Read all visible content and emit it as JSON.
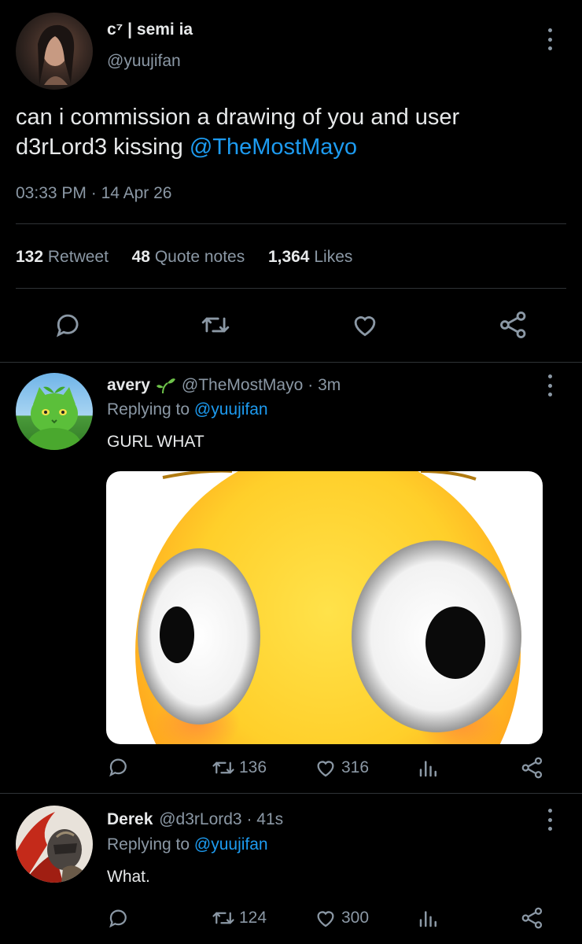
{
  "main_tweet": {
    "display_name": "c⁷ | semi ia",
    "handle": "@yuujifan",
    "text_part1": "can i commission a drawing of you and user",
    "text_part2": "d3rLord3 kissing",
    "mention": "@TheMostMayo",
    "time": "03:33 PM",
    "separator": "·",
    "date": "14 Apr 26",
    "stats": {
      "retweets_count": "132",
      "retweets_label": "Retweet",
      "quotes_count": "48",
      "quotes_label": "Quote notes",
      "likes_count": "1,364",
      "likes_label": "Likes"
    }
  },
  "reply1": {
    "display_name": "avery",
    "handle": "@TheMostMayo",
    "time": "· 3m",
    "replying_prefix": "Replying to",
    "replying_to": "@yuujifan",
    "text": "GURL WHAT",
    "retweets": "136",
    "likes": "316"
  },
  "reply2": {
    "display_name": "Derek",
    "handle": "@d3rLord3",
    "time": "· 41s",
    "replying_prefix": "Replying to",
    "replying_to": "@yuujifan",
    "text": "What.",
    "retweets": "124",
    "likes": "300"
  },
  "icons": [
    "more-icon",
    "reply-icon",
    "retweet-icon",
    "like-icon",
    "share-icon",
    "analytics-icon",
    "seedling-icon"
  ],
  "colors": {
    "background": "#000000",
    "text": "#e7e9ea",
    "muted": "#8b98a5",
    "link": "#1d9bf0",
    "divider": "#2f3336"
  }
}
